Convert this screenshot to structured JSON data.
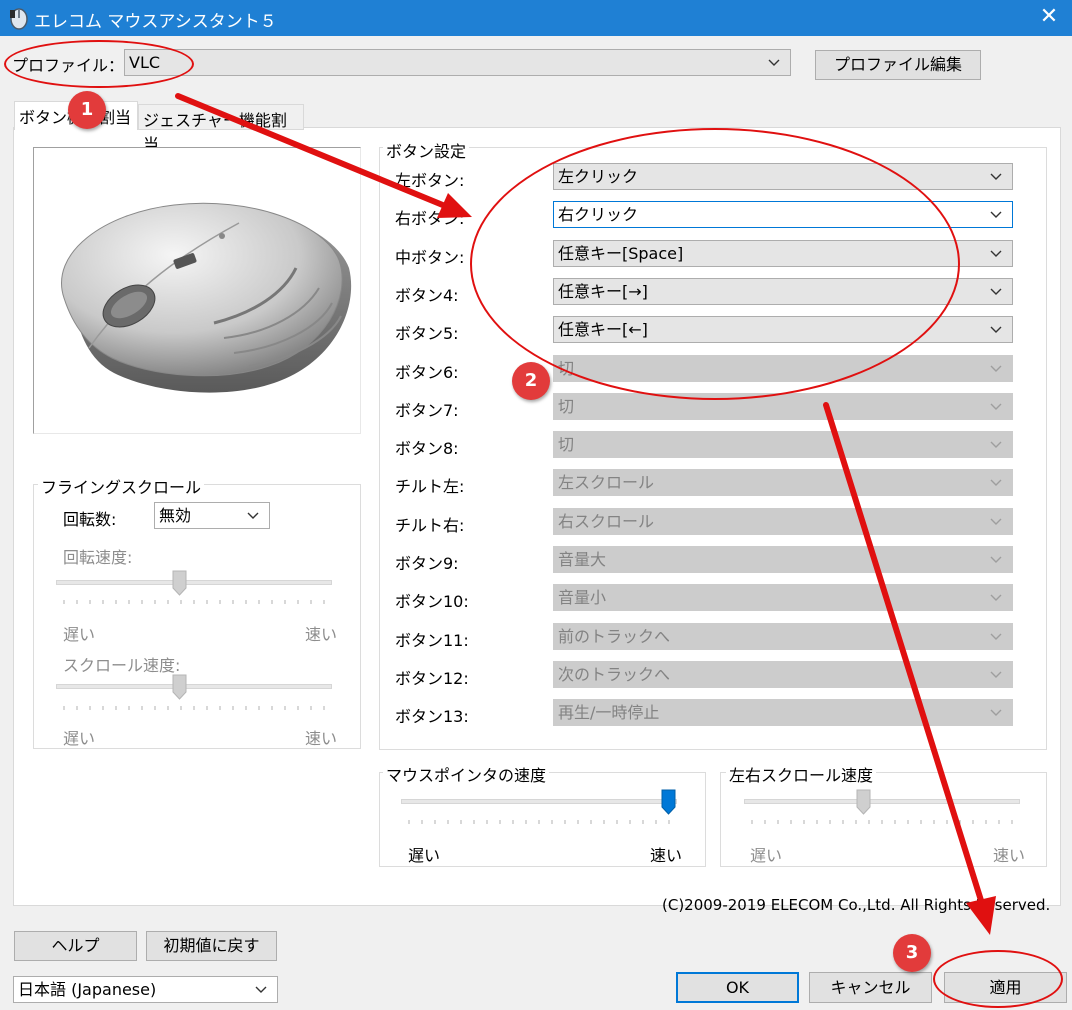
{
  "window": {
    "title": "エレコム マウスアシスタント５",
    "close_icon": "✕"
  },
  "profile": {
    "label": "プロファイル：",
    "value": "VLC",
    "edit_button": "プロファイル編集"
  },
  "tabs": [
    {
      "label": "ボタン機能割当",
      "active": true
    },
    {
      "label": "ジェスチャー機能割当",
      "active": false
    }
  ],
  "button_settings": {
    "legend": "ボタン設定",
    "rows": [
      {
        "label": "左ボタン:",
        "value": "左クリック",
        "enabled": true
      },
      {
        "label": "右ボタン:",
        "value": "右クリック",
        "enabled": true
      },
      {
        "label": "中ボタン:",
        "value": "任意キー[Space]",
        "enabled": true
      },
      {
        "label": "ボタン4:",
        "value": "任意キー[→]",
        "enabled": true
      },
      {
        "label": "ボタン5:",
        "value": "任意キー[←]",
        "enabled": true
      },
      {
        "label": "ボタン6:",
        "value": "切",
        "enabled": false
      },
      {
        "label": "ボタン7:",
        "value": "切",
        "enabled": false
      },
      {
        "label": "ボタン8:",
        "value": "切",
        "enabled": false
      },
      {
        "label": "チルト左:",
        "value": "左スクロール",
        "enabled": false
      },
      {
        "label": "チルト右:",
        "value": "右スクロール",
        "enabled": false
      },
      {
        "label": "ボタン9:",
        "value": "音量大",
        "enabled": false
      },
      {
        "label": "ボタン10:",
        "value": "音量小",
        "enabled": false
      },
      {
        "label": "ボタン11:",
        "value": "前のトラックへ",
        "enabled": false
      },
      {
        "label": "ボタン12:",
        "value": "次のトラックへ",
        "enabled": false
      },
      {
        "label": "ボタン13:",
        "value": "再生/一時停止",
        "enabled": false
      }
    ]
  },
  "flying_scroll": {
    "legend": "フライングスクロール",
    "rotation_label": "回転数:",
    "rotation_value": "無効",
    "rotation_speed_label": "回転速度:",
    "scroll_speed_label": "スクロール速度:",
    "slow": "遅い",
    "fast": "速い",
    "rotation_speed_level": 0.5,
    "scroll_speed_level": 0.5
  },
  "pointer_speed": {
    "legend": "マウスポインタの速度",
    "slow": "遅い",
    "fast": "速い",
    "level": 1.0
  },
  "horizontal_scroll_speed": {
    "legend": "左右スクロール速度",
    "slow": "遅い",
    "fast": "速い",
    "level": 0.5
  },
  "copyright": "(C)2009-2019 ELECOM Co.,Ltd. All Rights Reserved.",
  "bottom": {
    "help": "ヘルプ",
    "reset": "初期値に戻す",
    "language": "日本語 (Japanese)",
    "ok": "OK",
    "cancel": "キャンセル",
    "apply": "適用"
  },
  "annotations": {
    "badges": [
      "1",
      "2",
      "3"
    ],
    "color": "#e01010"
  },
  "colors": {
    "titlebar": "#1f80d4",
    "accent": "#0078d7",
    "disabled_combo": "#cccccc"
  }
}
